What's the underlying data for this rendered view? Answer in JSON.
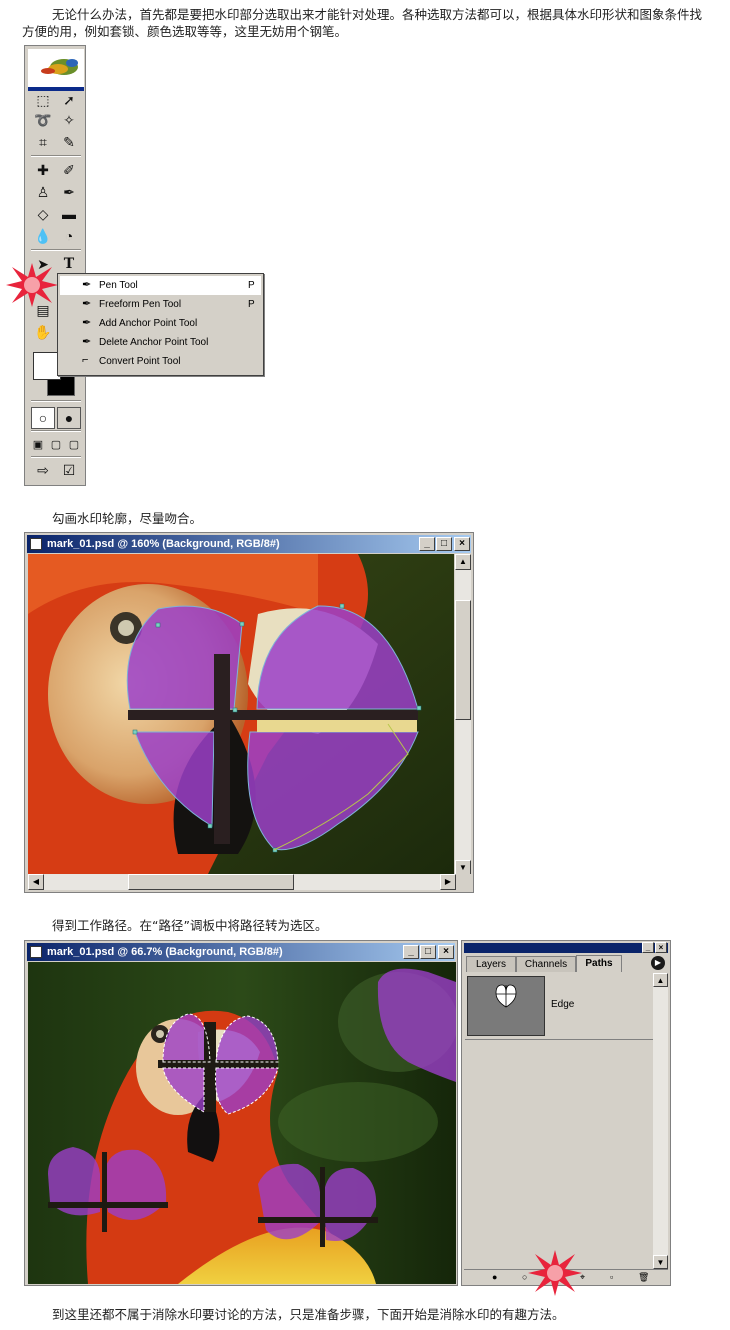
{
  "intro_text": "无论什么办法，首先都是要把水印部分选取出来才能针对处理。各种选取方法都可以，根据具体水印形状和图象条件找方便的用，例如套锁、颜色选取等等，这里无妨用个钢笔。",
  "flyout": {
    "items": [
      {
        "label": "Pen Tool",
        "shortcut": "P"
      },
      {
        "label": "Freeform Pen Tool",
        "shortcut": "P"
      },
      {
        "label": "Add Anchor Point Tool",
        "shortcut": ""
      },
      {
        "label": "Delete Anchor Point Tool",
        "shortcut": ""
      },
      {
        "label": "Convert Point Tool",
        "shortcut": ""
      }
    ]
  },
  "caption_outline": "勾画水印轮廓，尽量吻合。",
  "window1": {
    "title": "mark_01.psd @ 160% (Background, RGB/8#)",
    "btn_min": "_",
    "btn_max": "□",
    "btn_close": "×"
  },
  "caption_path": "得到工作路径。在“路径”调板中将路径转为选区。",
  "window2": {
    "title": "mark_01.psd @ 66.7% (Background, RGB/8#)",
    "btn_min": "_",
    "btn_max": "□",
    "btn_close": "×"
  },
  "paths_panel": {
    "tabs": [
      "Layers",
      "Channels",
      "Paths"
    ],
    "active_tab": "Paths",
    "path_name": "Edge"
  },
  "footer_text": "到这里还都不属于消除水印要讨论的方法，只是准备步骤，下面开始是消除水印的有趣方法。",
  "colors": {
    "title_gradient_start": "#0a246a",
    "title_gradient_end": "#a6caf0",
    "panel_gray": "#d4d0c8",
    "watermark_purple": "#9b3fc8"
  }
}
